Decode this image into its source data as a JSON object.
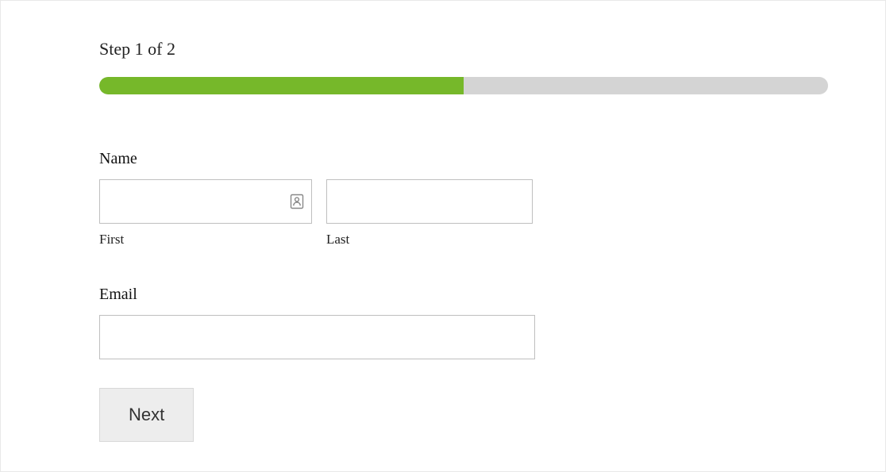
{
  "progress": {
    "label": "Step 1 of 2",
    "percent": 50
  },
  "form": {
    "name": {
      "label": "Name",
      "first": {
        "sublabel": "First",
        "value": ""
      },
      "last": {
        "sublabel": "Last",
        "value": ""
      }
    },
    "email": {
      "label": "Email",
      "value": ""
    },
    "nextButton": "Next"
  }
}
